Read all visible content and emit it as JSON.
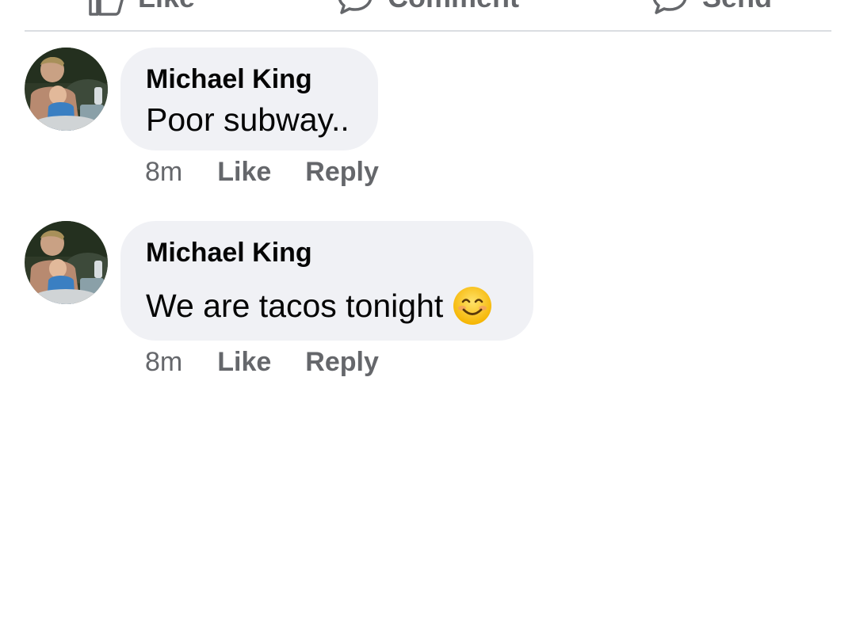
{
  "action_bar": {
    "like_label": "Like",
    "comment_label": "Comment",
    "send_label": "Send"
  },
  "comments": [
    {
      "author": "Michael King",
      "text": "Poor subway..",
      "emoji": "",
      "time": "8m",
      "like_label": "Like",
      "reply_label": "Reply"
    },
    {
      "author": "Michael King",
      "text": "We are tacos tonight",
      "emoji": "smiling-face-icon",
      "time": "8m",
      "like_label": "Like",
      "reply_label": "Reply"
    }
  ],
  "colors": {
    "bubble": "#f0f1f5",
    "secondary_text": "#65676b",
    "primary_text": "#050505",
    "divider": "#dadde1"
  }
}
